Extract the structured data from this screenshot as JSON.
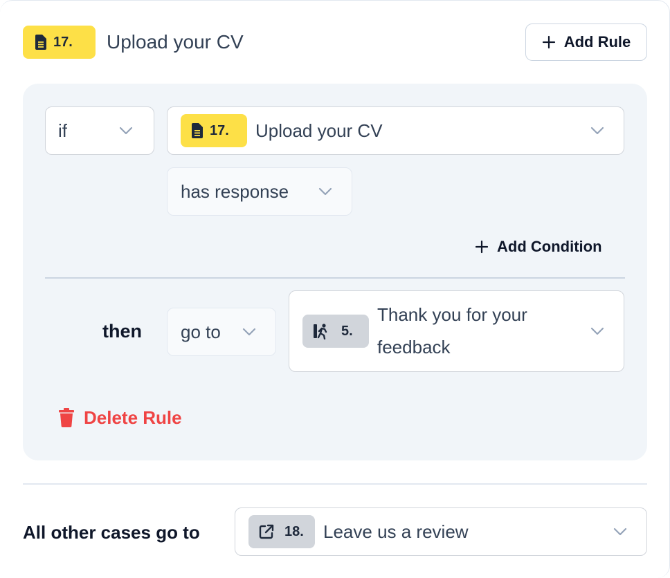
{
  "header": {
    "badge_number": "17.",
    "title": "Upload your CV",
    "add_rule_label": "Add Rule"
  },
  "rule": {
    "if_select": {
      "value": "if"
    },
    "question_select": {
      "badge_number": "17.",
      "value": "Upload your CV"
    },
    "condition_select": {
      "value": "has response"
    },
    "add_condition_label": "Add Condition",
    "then_label": "then",
    "action_select": {
      "value": "go to"
    },
    "target_select": {
      "badge_number": "5.",
      "value": "Thank you for your feedback"
    },
    "delete_rule_label": "Delete Rule"
  },
  "footer": {
    "label": "All other cases go to",
    "target_select": {
      "badge_number": "18.",
      "value": "Leave us a review"
    }
  },
  "colors": {
    "badge_yellow": "#fde047",
    "badge_gray": "#d1d5db",
    "danger": "#ef4444",
    "panel_bg": "#f1f5f9"
  },
  "icons": {
    "question_type": "document-icon",
    "end_screen": "person-running-icon",
    "external_link": "external-link-icon",
    "add": "plus-icon",
    "dropdown": "chevron-down-icon",
    "delete": "trash-icon"
  }
}
